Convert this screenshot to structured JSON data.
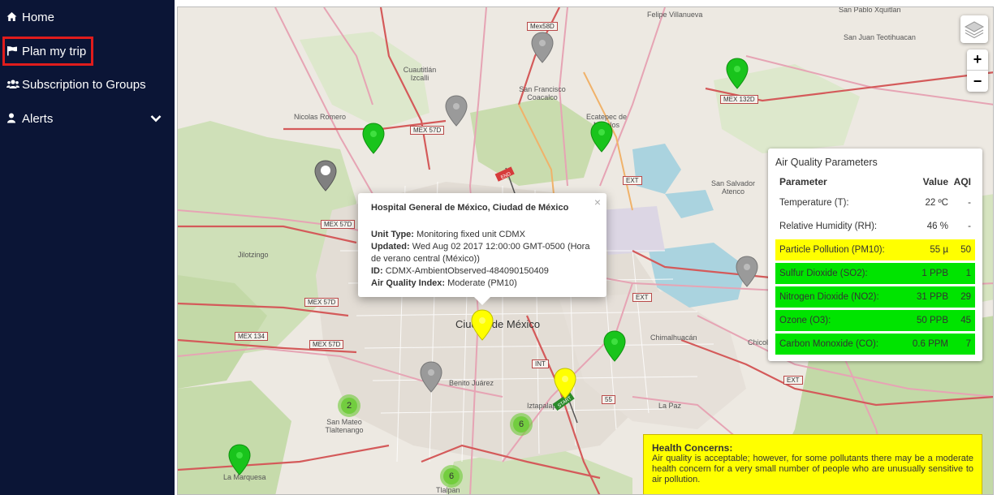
{
  "sidebar": {
    "items": [
      {
        "label": "Home",
        "icon": "home-icon"
      },
      {
        "label": "Plan my trip",
        "icon": "flag-icon"
      },
      {
        "label": "Subscription to Groups",
        "icon": "users-icon"
      },
      {
        "label": "Alerts",
        "icon": "user-icon"
      }
    ],
    "alerts_expand_icon": "chevron-down-icon"
  },
  "map": {
    "places": {
      "felipe": "Felipe Villanueva",
      "san_pablo": "San Pablo Xquitlan",
      "san_juan": "San Juan Teotihuacan",
      "cuautitlan": "Cuautitlán Izcalli",
      "san_francisco": "San Francisco Coacalco",
      "nicolas": "Nicolas Romero",
      "ecatepec": "Ecatepec de Morelos",
      "san_salvador": "San Salvador Atenco",
      "jilotzingo": "Jilotzingo",
      "cdmx": "Ciudad de México",
      "benito": "Benito Juárez",
      "iztapalapa": "Iztapalapa",
      "chimalhuacan": "Chimalhuacán",
      "chicoloapan": "Chicoloapan",
      "la_paz": "La Paz",
      "san_mateo": "San Mateo Tlaltenango",
      "la_marquesa": "La Marquesa",
      "tlalpan": "Tlalpan"
    },
    "shields": {
      "mex58d": "Mex58D",
      "mex57d_top": "MEX 57D",
      "mex132d": "MEX 132D",
      "mex57d_a": "MEX 57D",
      "mex57d_b": "MEX 57D",
      "mex57d_c": "MEX 57D",
      "mex134": "MEX 134",
      "ext_1": "EXT",
      "ext_2": "EXT",
      "ext_3": "EXT",
      "int": "INT",
      "n55": "55"
    },
    "route_flags": {
      "start": "START",
      "end": "END"
    },
    "clusters": [
      "2",
      "6",
      "6"
    ],
    "marker_colors": {
      "green": "#19c41c",
      "yellow": "#ffff00",
      "gray": "#9a9a9a"
    },
    "zoom_in": "+",
    "zoom_out": "−",
    "layers_icon": "layers-icon"
  },
  "popup": {
    "title": "Hospital General de México, Ciudad de México",
    "close": "×",
    "unit_type_label": "Unit Type:",
    "unit_type_value": "Monitoring fixed unit CDMX",
    "updated_label": "Updated:",
    "updated_value": "Wed Aug 02 2017 12:00:00 GMT-0500 (Hora de verano central (México))",
    "id_label": "ID:",
    "id_value": "CDMX-AmbientObserved-484090150409",
    "aqi_label": "Air Quality Index:",
    "aqi_value": "Moderate (PM10)"
  },
  "aq_panel": {
    "title": "Air Quality Parameters",
    "headers": {
      "parameter": "Parameter",
      "value": "Value",
      "aqi": "AQI"
    },
    "rows": [
      {
        "parameter": "Temperature (T):",
        "value": "22 ºC",
        "aqi": "-",
        "color": "#ffffff"
      },
      {
        "parameter": "Relative Humidity (RH):",
        "value": "46 %",
        "aqi": "-",
        "color": "#ffffff"
      },
      {
        "parameter": "Particle Pollution (PM10):",
        "value": "55 µ",
        "aqi": "50",
        "color": "#ffff00"
      },
      {
        "parameter": "Sulfur Dioxide (SO2):",
        "value": "1 PPB",
        "aqi": "1",
        "color": "#00e400"
      },
      {
        "parameter": "Nitrogen Dioxide (NO2):",
        "value": "31 PPB",
        "aqi": "29",
        "color": "#00e400"
      },
      {
        "parameter": "Ozone (O3):",
        "value": "50 PPB",
        "aqi": "45",
        "color": "#00e400"
      },
      {
        "parameter": "Carbon Monoxide (CO):",
        "value": "0.6 PPM",
        "aqi": "7",
        "color": "#00e400"
      }
    ]
  },
  "health": {
    "title": "Health Concerns:",
    "text": "Air quality is acceptable; however, for some pollutants there may be a moderate health concern for a very small number of people who are unusually sensitive to air pollution."
  }
}
